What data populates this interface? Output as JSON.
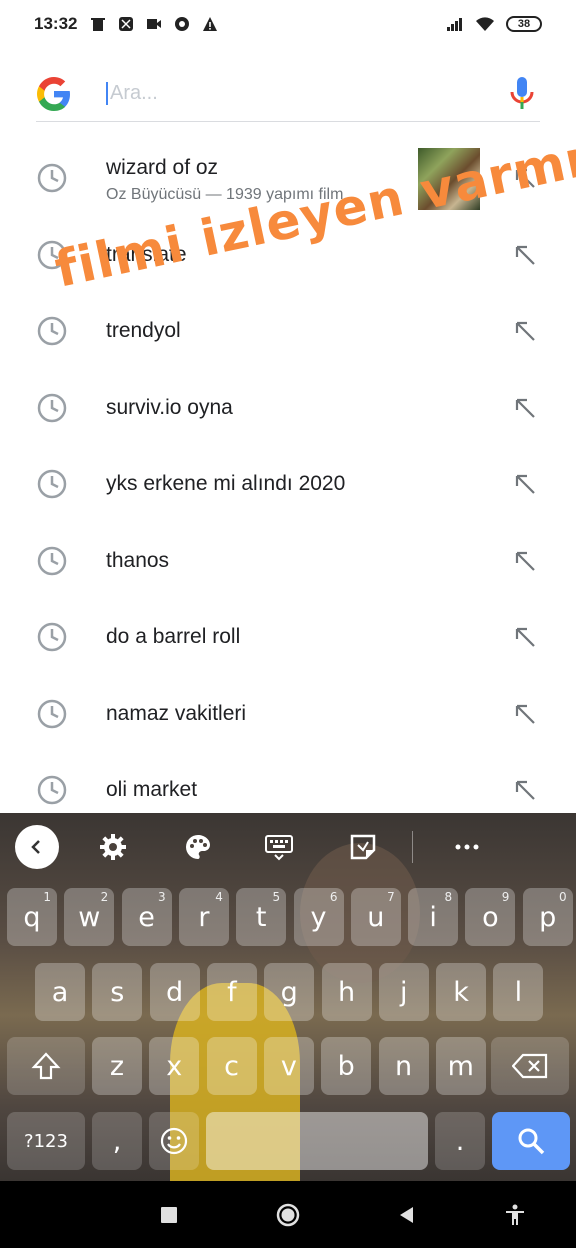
{
  "status_bar": {
    "time": "13:32",
    "left_icons": [
      "trash-icon",
      "app-icon",
      "video-icon",
      "chrome-icon",
      "warning-icon"
    ],
    "battery": "38"
  },
  "search": {
    "placeholder": "Ara...",
    "value": ""
  },
  "suggestions": [
    {
      "text": "wizard of oz",
      "subtitle": "Oz Büyücüsü — 1939 yapımı film",
      "has_thumbnail": true
    },
    {
      "text": "translate"
    },
    {
      "text": "trendyol"
    },
    {
      "text": "surviv.io oyna"
    },
    {
      "text": "yks erkene mi alındı 2020"
    },
    {
      "text": "thanos"
    },
    {
      "text": "do a barrel roll"
    },
    {
      "text": "namaz vakitleri"
    },
    {
      "text": "oli market"
    }
  ],
  "overlay_text": "filmi izleyen varmı",
  "keyboard": {
    "toolbar": [
      "back-icon",
      "settings-icon",
      "palette-icon",
      "keyboard-icon",
      "sticker-icon",
      "more-icon"
    ],
    "row1": [
      {
        "k": "q",
        "h": "1"
      },
      {
        "k": "w",
        "h": "2"
      },
      {
        "k": "e",
        "h": "3"
      },
      {
        "k": "r",
        "h": "4"
      },
      {
        "k": "t",
        "h": "5"
      },
      {
        "k": "y",
        "h": "6"
      },
      {
        "k": "u",
        "h": "7"
      },
      {
        "k": "i",
        "h": "8"
      },
      {
        "k": "o",
        "h": "9"
      },
      {
        "k": "p",
        "h": "0"
      }
    ],
    "row2": [
      "a",
      "s",
      "d",
      "f",
      "g",
      "h",
      "j",
      "k",
      "l"
    ],
    "row3": [
      "z",
      "x",
      "c",
      "v",
      "b",
      "n",
      "m"
    ],
    "symbols_label": "?123",
    "comma": ",",
    "period": "."
  },
  "colors": {
    "accent": "#4285f4",
    "overlay": "#f78a3c",
    "enter_key": "#5e97f6"
  }
}
